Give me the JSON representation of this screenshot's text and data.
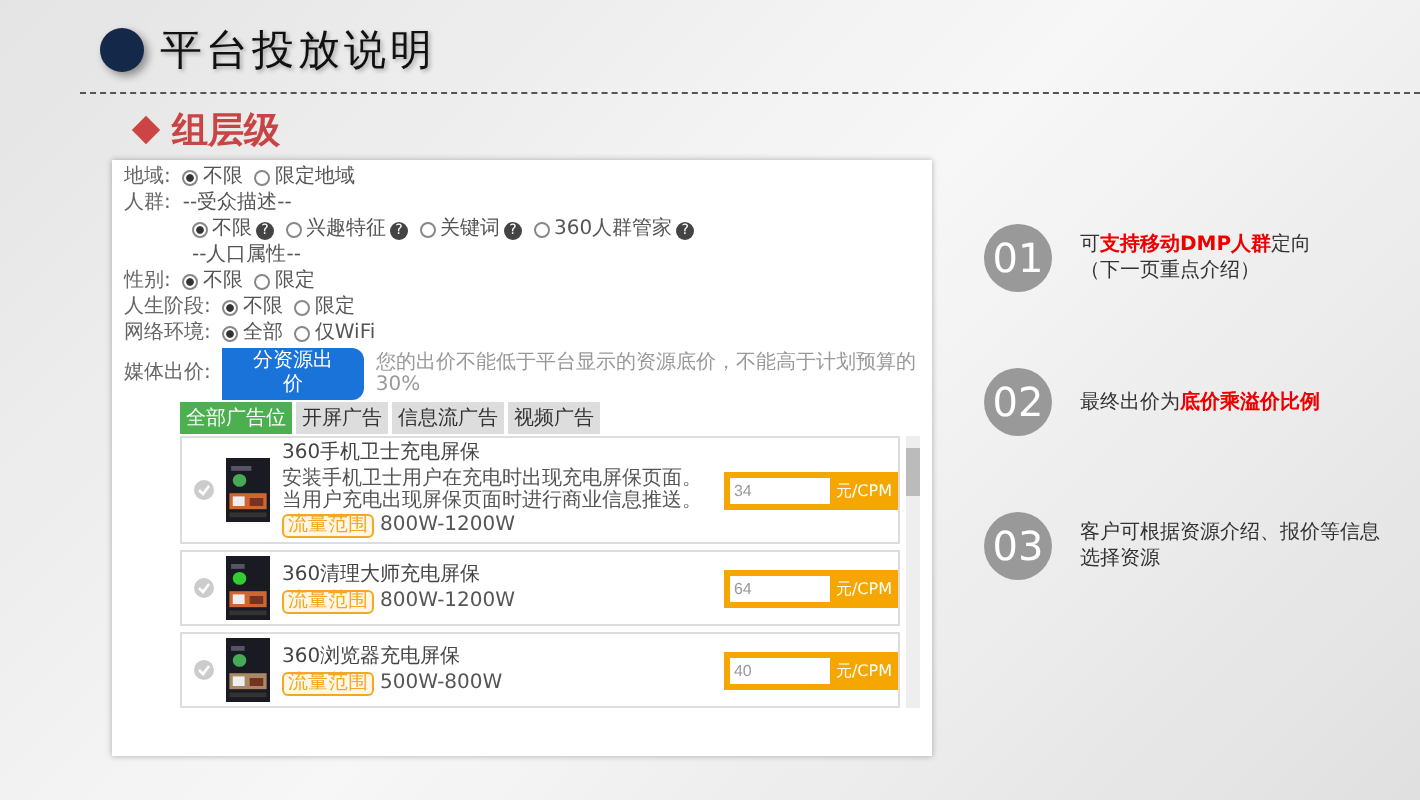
{
  "slide": {
    "title": "平台投放说明",
    "subtitle": "组层级"
  },
  "form": {
    "rows": [
      {
        "kind": "radio",
        "label": "地域:",
        "options": [
          {
            "label": "不限",
            "selected": true
          },
          {
            "label": "限定地域",
            "selected": false
          }
        ]
      },
      {
        "kind": "heading",
        "label": "人群:",
        "text": "--受众描述--"
      },
      {
        "kind": "radio",
        "options": [
          {
            "label": "不限",
            "selected": true,
            "help": "?"
          },
          {
            "label": "兴趣特征",
            "selected": false,
            "help": "?"
          },
          {
            "label": "关键词",
            "selected": false,
            "help": "?"
          },
          {
            "label": "360人群管家",
            "selected": false,
            "help": "?"
          }
        ]
      },
      {
        "kind": "heading",
        "text": "--人口属性--"
      },
      {
        "kind": "radio",
        "label": "性别:",
        "options": [
          {
            "label": "不限",
            "selected": true
          },
          {
            "label": "限定",
            "selected": false
          }
        ]
      },
      {
        "kind": "radio",
        "label": "人生阶段:",
        "options": [
          {
            "label": "不限",
            "selected": true
          },
          {
            "label": "限定",
            "selected": false
          }
        ]
      },
      {
        "kind": "radio",
        "label": "网络环境:",
        "options": [
          {
            "label": "全部",
            "selected": true
          },
          {
            "label": "仅WiFi",
            "selected": false
          }
        ]
      },
      {
        "kind": "bid",
        "label": "媒体出价:",
        "button": "分资源出价",
        "hint": "您的出价不能低于平台显示的资源底价，不能高于计划预算的30%"
      }
    ],
    "tabs": [
      {
        "label": "全部广告位",
        "selected": true
      },
      {
        "label": "开屏广告",
        "selected": false
      },
      {
        "label": "信息流广告",
        "selected": false
      },
      {
        "label": "视频广告",
        "selected": false
      }
    ],
    "cards": [
      {
        "title": "360手机卫士充电屏保",
        "description": "安装手机卫士用户在充电时出现充电屏保页面。当用户充电出现屏保页面时进行商业信息推送。",
        "tag": "流量范围",
        "range": "800W-1200W",
        "price": "34",
        "unit": "元/CPM"
      },
      {
        "title": "360清理大师充电屏保",
        "tag": "流量范围",
        "range": "800W-1200W",
        "price": "64",
        "unit": "元/CPM"
      },
      {
        "title": "360浏览器充电屏保",
        "tag": "流量范围",
        "range": "500W-800W",
        "price": "40",
        "unit": "元/CPM"
      }
    ]
  },
  "points": [
    {
      "number": "01",
      "text": "可**支持移动DMP人群**定向",
      "note": "（下一页重点介绍）"
    },
    {
      "number": "02",
      "text": "最终出价为**底价乘溢价比例**"
    },
    {
      "number": "03",
      "text": "客户可根据资源介绍、报价等信息选择资源"
    }
  ]
}
